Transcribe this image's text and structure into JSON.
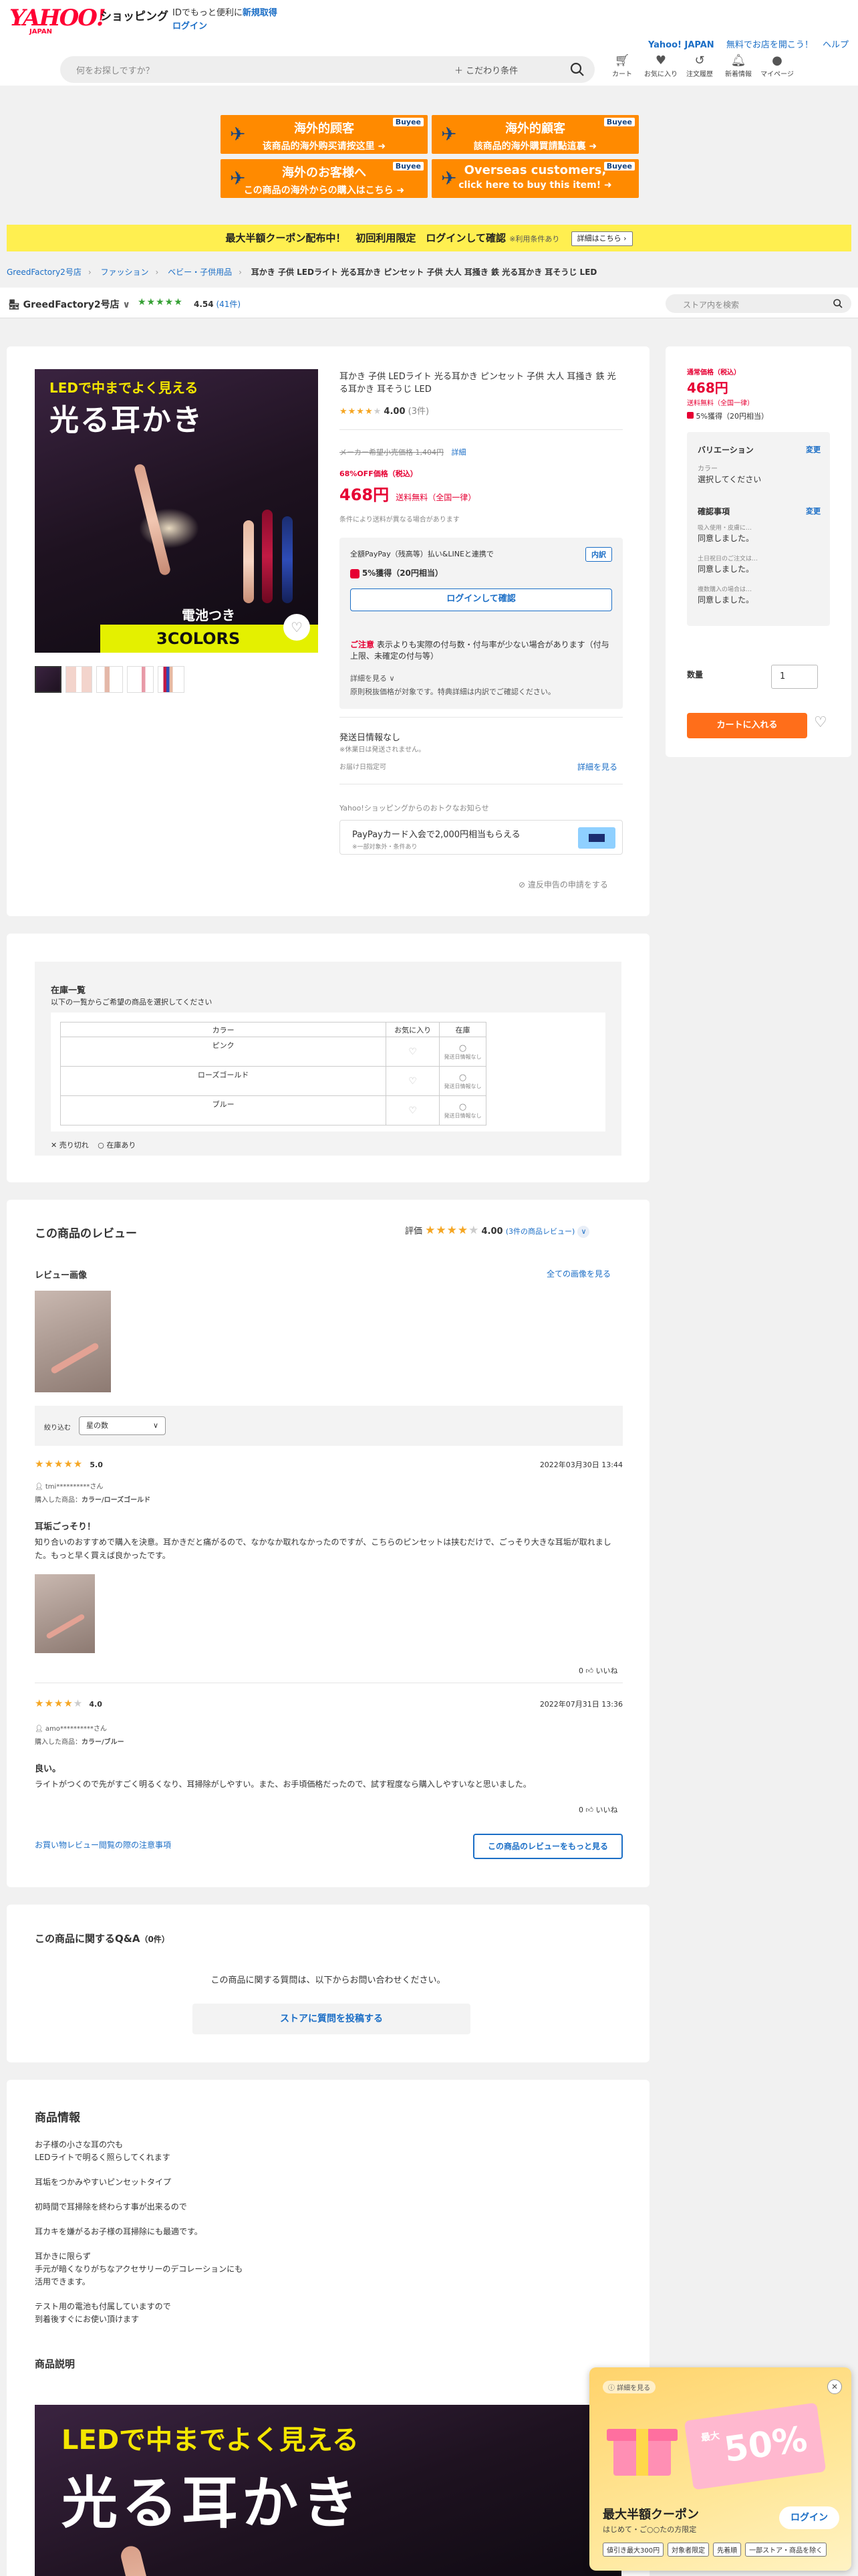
{
  "header": {
    "logo": "YAHOO! JAPAN",
    "logo_main": "YAHOO!",
    "logo_sub": "JAPAN",
    "shop_name": "ショッピング",
    "promo_text": "IDでもっと便利に",
    "register_link": "新規取得",
    "login_link": "ログイン",
    "yahoo_japan_link": "Yahoo! JAPAN",
    "free_app_link": "無料でお店を開こう！",
    "help_link": "ヘルプ",
    "search_placeholder": "何をお探しですか？",
    "conditions_label": "＋ こだわり条件",
    "icons": [
      {
        "icon": "cart-icon",
        "label": "カート"
      },
      {
        "icon": "heart-icon",
        "label": "お気に入り"
      },
      {
        "icon": "history-icon",
        "label": "注文履歴"
      },
      {
        "icon": "bell-icon",
        "label": "新着情報"
      },
      {
        "icon": "person-icon",
        "label": "マイページ"
      }
    ]
  },
  "banners": [
    {
      "line1": "海外的顾客",
      "line2": "该商品的海外购买请按这里 ➜",
      "brand": "Buyee"
    },
    {
      "line1": "海外的顧客",
      "line2": "該商品的海外購買請點這裏 ➜",
      "brand": "Buyee"
    },
    {
      "line1": "海外のお客様へ",
      "line2": "この商品の海外からの購入はこちら ➜",
      "brand": "Buyee"
    },
    {
      "line1": "Overseas customers,",
      "line2": "click here to buy this item! ➜",
      "brand": "Buyee"
    }
  ],
  "coupon_strip": {
    "text": "最大半額クーポン配布中！　初回利用限定　ログインして確認",
    "note": "※利用条件あり",
    "button": "詳細はこちら ›"
  },
  "breadcrumbs": [
    "GreedFactory2号店",
    "ファッション",
    "ベビー・子供用品"
  ],
  "breadcrumb_current": "耳かき 子供 LEDライト 光る耳かき ピンセット 子供 大人 耳掻き 鉄 光る耳かき 耳そうじ LED",
  "store": {
    "name": "GreedFactory2号店",
    "stars": "★★★★★",
    "rating": "4.54",
    "count": "(41件)",
    "search_placeholder": "ストア内を検索"
  },
  "product": {
    "image_caption1": "LEDで中までよく見える",
    "image_caption2": "光る耳かき",
    "image_battery": "電池つき",
    "image_colors": "3COLORS",
    "title": "耳かき 子供 LEDライト 光る耳かき ピンセット 子供 大人 耳掻き 鉄 光る耳かき 耳そうじ LED",
    "stars": "★★★★",
    "rating": "4.00",
    "review_count": "(3件)",
    "list_price_label": "メーカー希望小売価格",
    "list_price": "1,404円",
    "detail_link": "詳細",
    "discount": "68%OFF価格（税込）",
    "price": "468円",
    "shipping": "送料無料（全国一律）",
    "shipping_note": "条件により送料が異なる場合があります",
    "paypay_box": {
      "text": "全額PayPay（残高等）払い&LINEと連携で",
      "tag": "内訳",
      "reward": "5%獲得（20円相当）",
      "login_button": "ログインして確認",
      "caution_label": "ご注意",
      "caution_text": "表示よりも実際の付与数・付与率が少ない場合があります（付与上限、未確定の付与等）",
      "more": "詳細を見る ∨",
      "note": "原則税抜価格が対象です。特典詳細は内訳でご確認ください。"
    },
    "ship_info_title": "発送日情報なし",
    "ship_info_note": "※休業日は発送されません。",
    "ship_date_label": "お届け日指定可",
    "ship_more_link": "詳細を見る",
    "notice_label": "Yahoo!ショッピングからのおトクなお知らせ",
    "card_promo": "PayPayカード入会で2,000円相当もらえる",
    "card_promo_note": "※一部対象外・条件あり",
    "report_link": "違反申告の申請をする"
  },
  "buybox": {
    "price_label": "通常価格（税込）",
    "price": "468円",
    "shipping": "送料無料（全国一律）",
    "reward": "5%獲得（20円相当）",
    "variation_title": "バリエーション",
    "change": "変更",
    "color_label": "カラー",
    "color_value": "選択してください",
    "confirm_title": "確認事項",
    "confirm_items": [
      {
        "note": "吸入使用・皮膚に…",
        "value": "同意しました。"
      },
      {
        "note": "土日祝日のご注文は…",
        "value": "同意しました。"
      },
      {
        "note": "複数購入の場合は…",
        "value": "同意しました。"
      }
    ],
    "qty_label": "数量",
    "qty_value": "1",
    "cart_button": "カートに入れる"
  },
  "inventory": {
    "title": "在庫一覧",
    "subtitle": "以下の一覧からご希望の商品を選択してください",
    "headers": [
      "カラー",
      "お気に入り",
      "在庫"
    ],
    "rows": [
      {
        "color": "ピンク",
        "stock": "発送日情報なし"
      },
      {
        "color": "ローズゴールド",
        "stock": "発送日情報なし"
      },
      {
        "color": "ブルー",
        "stock": "発送日情報なし"
      }
    ],
    "legend_soldout": "売り切れ",
    "legend_instock": "在庫あり"
  },
  "reviews": {
    "title": "この商品のレビュー",
    "rating_label": "評価",
    "stars": "★★★★",
    "rating": "4.00",
    "count": "(3件の商品レビュー)",
    "images_title": "レビュー画像",
    "all_images_link": "全ての画像を見る",
    "filter_label": "絞り込む",
    "filter_value": "星の数",
    "items": [
      {
        "stars": "★★★★★",
        "score": "5.0",
        "date": "2022年03月30日 13:44",
        "user": "tmi**********さん",
        "item_label": "購入した商品：",
        "item": "カラー/ローズゴールド",
        "title": "耳垢ごっそり！",
        "body": "知り合いのおすすめで購入を決意。耳かきだと痛がるので、なかなか取れなかったのですが、こちらのピンセットは挟むだけで、ごっそり大きな耳垢が取れました。もっと早く買えば良かったです。",
        "helpful": "0",
        "helpful_label": "いいね"
      },
      {
        "stars": "★★★★",
        "score": "4.0",
        "date": "2022年07月31日 13:36",
        "user": "amo**********さん",
        "item_label": "購入した商品：",
        "item": "カラー/ブルー",
        "title": "良い。",
        "body": "ライトがつくので先がすごく明るくなり、耳掃除がしやすい。また、お手頃価格だったので、試す程度なら購入しやすいなと思いました。",
        "helpful": "0",
        "helpful_label": "いいね"
      }
    ],
    "guide_link": "お買い物レビュー閲覧の際の注意事項",
    "more_button": "この商品のレビューをもっと見る"
  },
  "qa": {
    "title": "この商品に関するQ&A",
    "count": "（0件）",
    "text": "この商品に関する質問は、以下からお問い合わせください。",
    "button": "ストアに質問を投稿する"
  },
  "info": {
    "title": "商品情報",
    "paragraphs": [
      "お子様の小さな耳の穴も\nLEDライトで明るく照らしてくれます",
      "耳垢をつかみやすいピンセットタイプ",
      "初時間で耳掃除を終わらす事が出来るので",
      "耳カキを嫌がるお子様の耳掃除にも最適です。",
      "耳かきに限らず\n手元が暗くなりがちなアクセサリーのデコレーションにも\n活用できます。",
      "テスト用の電池も付属していますので\n到着後すぐにお使い頂けます"
    ],
    "desc_title": "商品説明",
    "desc_caption1": "LEDで中までよく見える",
    "desc_caption2": "光る耳かき"
  },
  "popup": {
    "badge": "ⓘ 詳細を見る",
    "percent": "50%",
    "percent_prefix": "最大",
    "title": "最大半額クーポン",
    "subtitle": "はじめて・ご○○たの方限定",
    "login": "ログイン",
    "tags": [
      "値引き最大300円",
      "対象者限定",
      "先着順",
      "一部ストア・商品を除く"
    ]
  },
  "colors": {
    "accent_red": "#e60033",
    "link_blue": "#1b6ec6",
    "orange": "#ff6e1a",
    "buyee_orange": "#ff8a00",
    "star_orange": "#f5a623",
    "store_green": "#35a034",
    "strip_yellow": "#ffef50"
  }
}
